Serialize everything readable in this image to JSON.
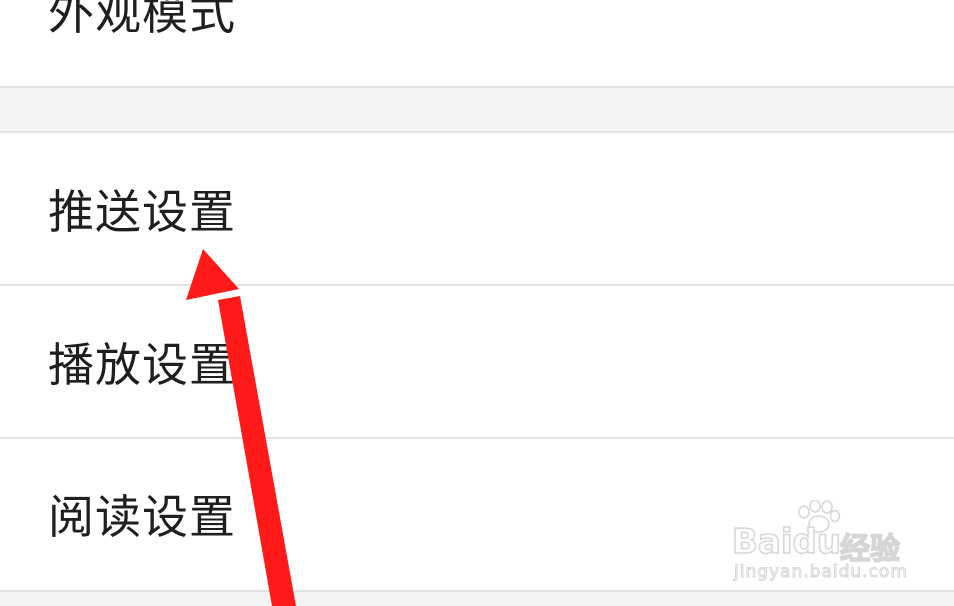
{
  "settings": {
    "items": [
      {
        "label": "外观模式"
      },
      {
        "label": "推送设置"
      },
      {
        "label": "播放设置"
      },
      {
        "label": "阅读设置"
      }
    ]
  },
  "annotation": {
    "arrow_color": "#ff1a1a",
    "arrow_target": "推送设置"
  },
  "watermark": {
    "brand": "Baidu",
    "brand_cn": "经验",
    "url": "jingyan.baidu.com"
  },
  "colors": {
    "background": "#ffffff",
    "section_gap": "#f4f4f4",
    "divider": "#e3e3e3",
    "text": "#1f1f1f"
  }
}
